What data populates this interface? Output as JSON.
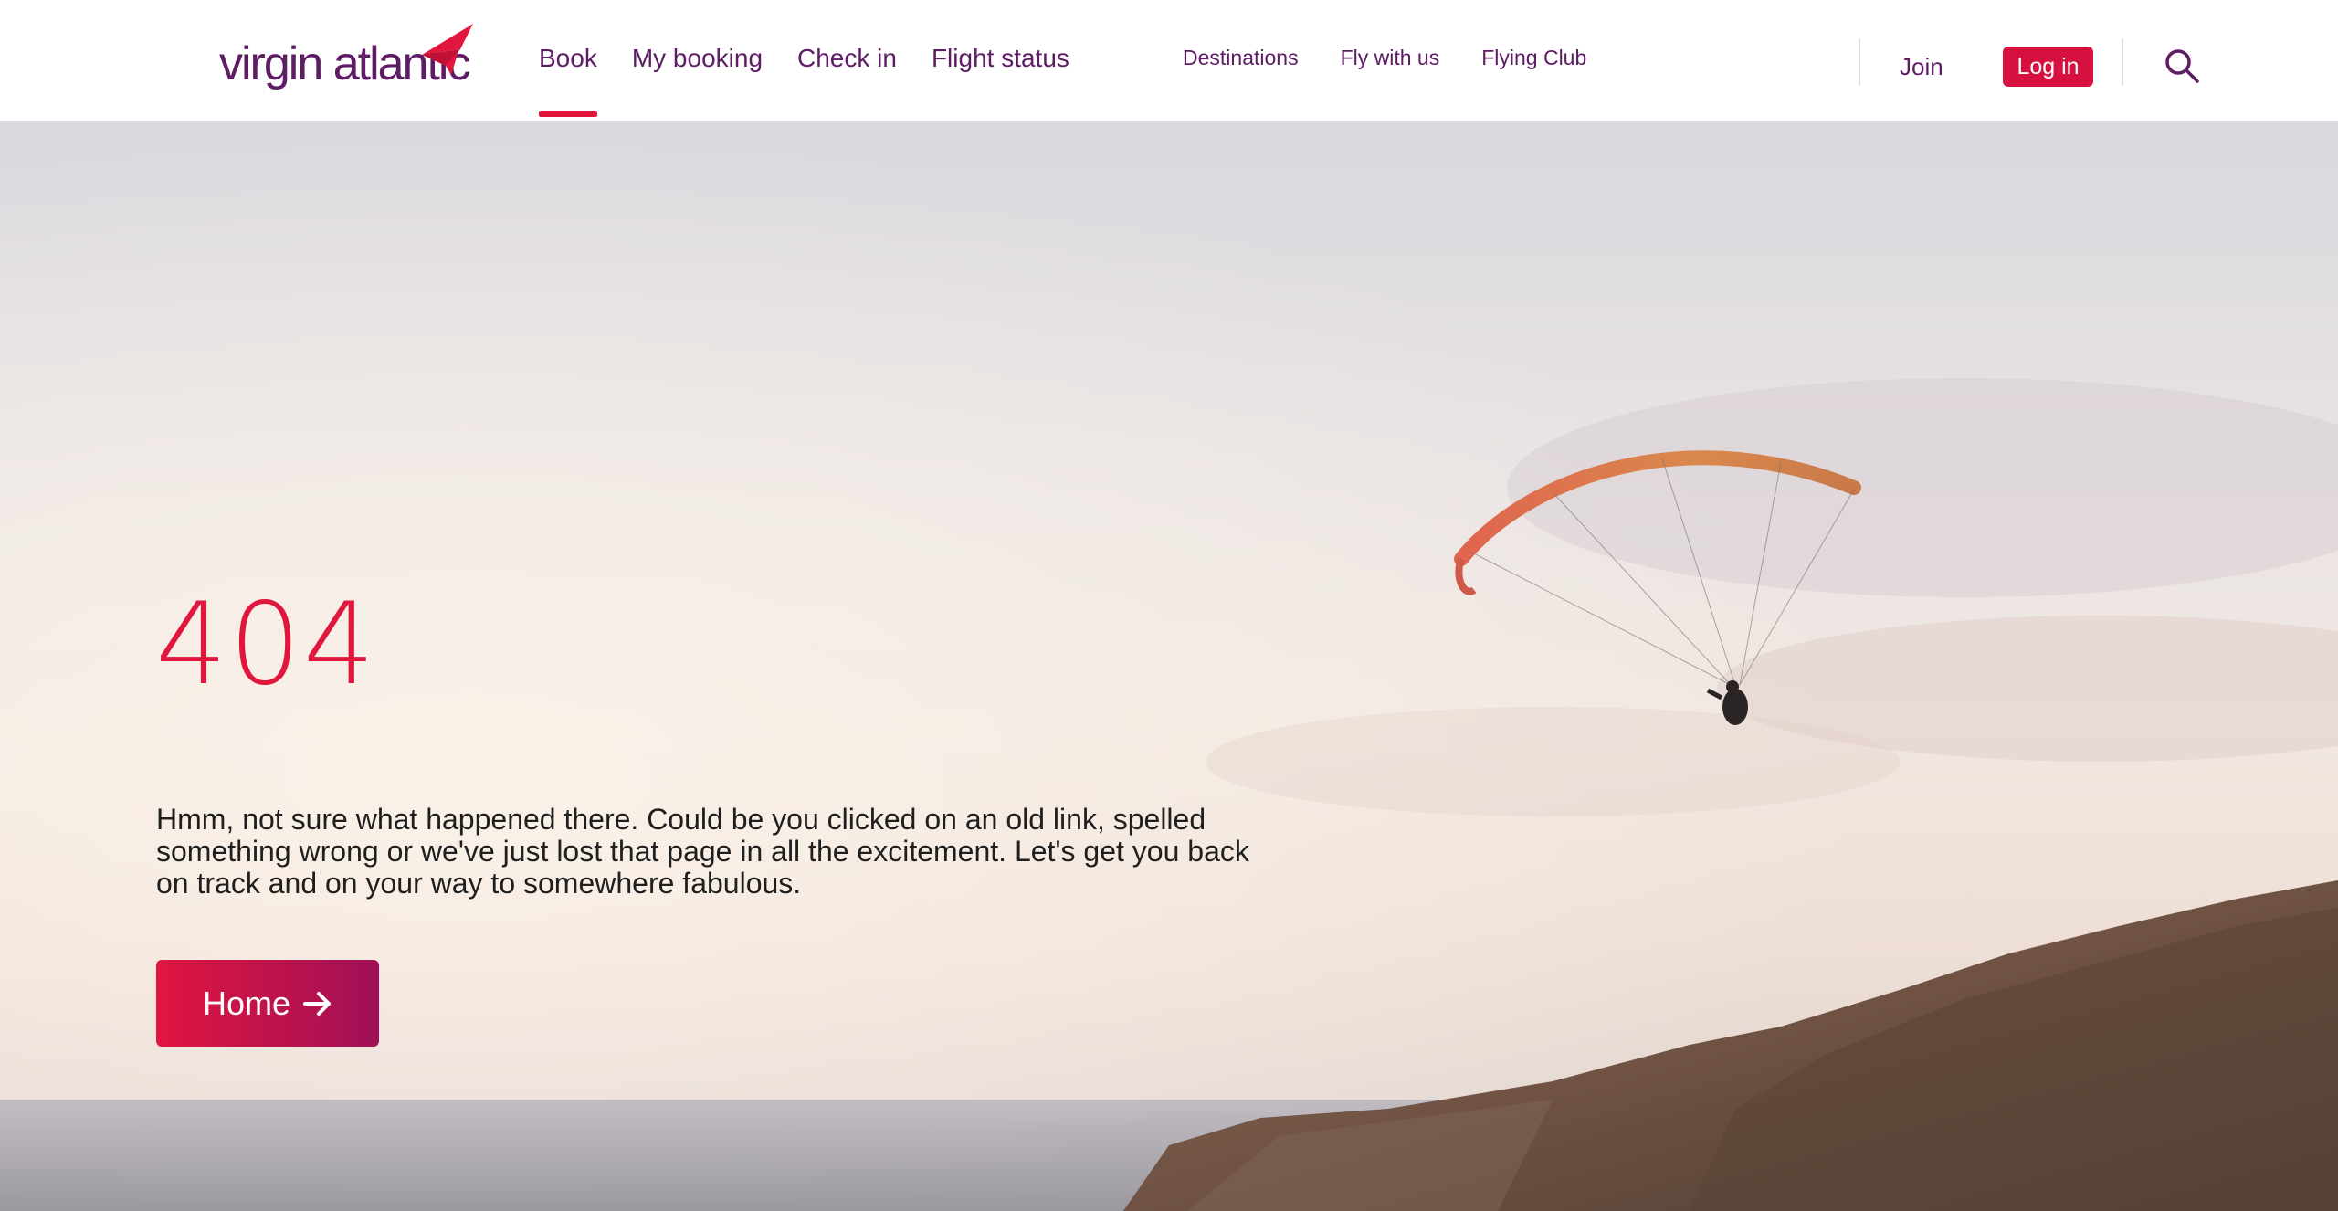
{
  "header": {
    "logo_text": "virgin atlantic",
    "primary_nav": [
      {
        "label": "Book",
        "active": true
      },
      {
        "label": "My booking",
        "active": false
      },
      {
        "label": "Check in",
        "active": false
      },
      {
        "label": "Flight status",
        "active": false
      }
    ],
    "secondary_nav": [
      {
        "label": "Destinations"
      },
      {
        "label": "Fly with us"
      },
      {
        "label": "Flying Club"
      }
    ],
    "join_label": "Join",
    "login_label": "Log in",
    "search_icon": "search-icon"
  },
  "hero": {
    "error_code": "404",
    "message": "Hmm, not sure what happened there. Could be you clicked on an old link, spelled something wrong or we've just lost that page in all the excitement. Let's get you back on track and on your way to somewhere fabulous.",
    "home_button_label": "Home",
    "home_button_icon": "arrow-right-icon"
  },
  "colors": {
    "brand_purple": "#5d1c64",
    "brand_red": "#e1163c"
  }
}
